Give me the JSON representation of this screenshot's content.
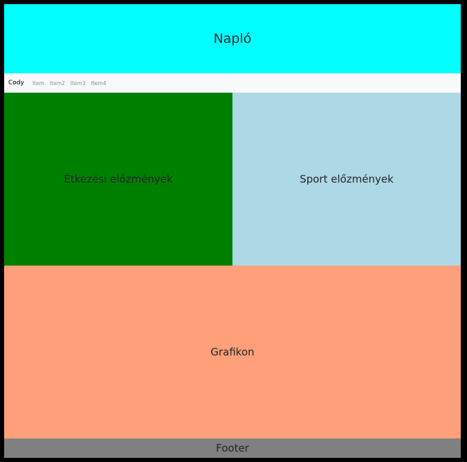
{
  "header": {
    "title": "Napló",
    "bg": "#00ffff"
  },
  "navbar": {
    "brand": "Cody",
    "items": [
      "Item",
      "Item2",
      "Item3",
      "Item4"
    ],
    "bg": "#f8f9fa"
  },
  "panels": {
    "food": {
      "title": "Étkezési előzmények",
      "bg": "#008000"
    },
    "sport": {
      "title": "Sport előzmények",
      "bg": "#add8e6"
    },
    "chart": {
      "title": "Grafikon",
      "bg": "#ffa07a"
    }
  },
  "footer": {
    "text": "Footer",
    "bg": "#808080"
  }
}
